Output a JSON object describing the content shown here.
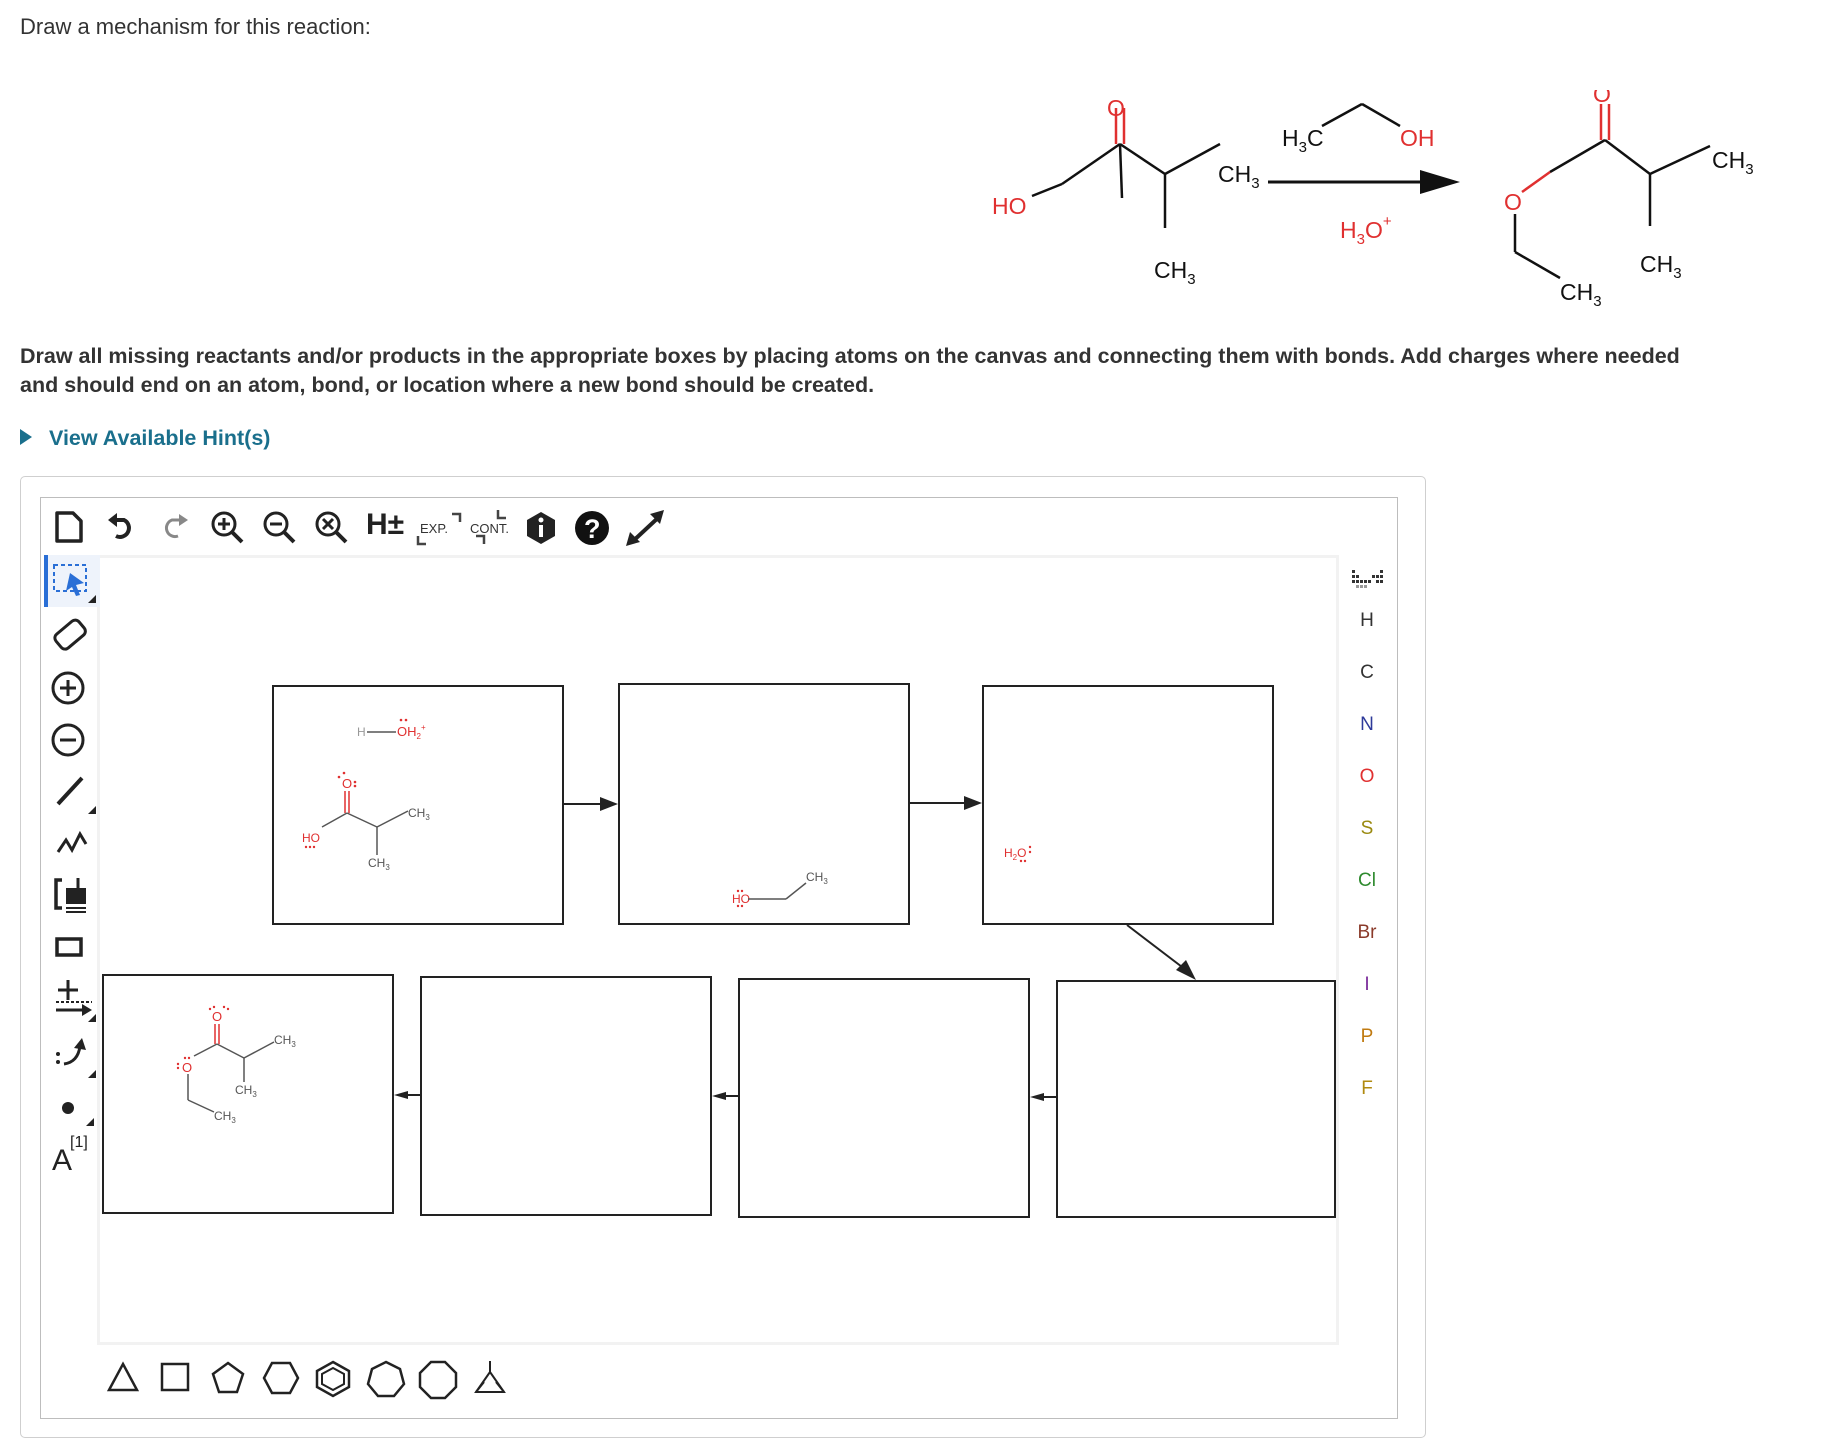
{
  "question": {
    "prompt": "Draw a mechanism for this reaction:",
    "instructions_line1": "Draw all missing reactants and/or products in the appropriate boxes by placing atoms on the canvas and connecting them with bonds. Add charges where needed",
    "instructions_line2": "and should end on an atom, bond, or location where a new bond should be created.",
    "hint_link": "View Available Hint(s)"
  },
  "reaction": {
    "reactant_labels": [
      "O",
      "HO",
      "CH3",
      "CH3"
    ],
    "reagent_labels": [
      "H3C",
      "OH",
      "H3O+"
    ],
    "product_labels": [
      "O",
      "O",
      "CH3",
      "CH3",
      "CH3"
    ]
  },
  "toolbar": {
    "h_toggle": "H±",
    "expand_label": "EXP.",
    "contract_label": "CONT."
  },
  "element_palette": [
    "H",
    "C",
    "N",
    "O",
    "S",
    "Cl",
    "Br",
    "I",
    "P",
    "F"
  ],
  "element_colors": {
    "H": "#333333",
    "C": "#333333",
    "N": "#2e3a9a",
    "O": "#e03030",
    "S": "#9a8a10",
    "Cl": "#2e8a2e",
    "Br": "#8a3a2a",
    "I": "#7a2a9a",
    "P": "#c07a10",
    "F": "#b08a10"
  },
  "left_tools": {
    "atom_map_label": "A",
    "atom_map_index": "[1]"
  },
  "mechanism_boxes": {
    "box1": {
      "labels": [
        "H",
        "OH2+",
        "O",
        "HO",
        "CH3",
        "CH3"
      ]
    },
    "box2": {
      "labels": [
        "HO",
        "CH3"
      ]
    },
    "box3": {
      "labels": [
        "H2O:"
      ]
    },
    "box8": {
      "labels": [
        "O",
        "O",
        "CH3",
        "CH3",
        "CH3"
      ]
    }
  },
  "template_shapes": [
    "triangle",
    "square",
    "pentagon",
    "hexagon",
    "benzene",
    "heptagon",
    "octagon",
    "bicyclic"
  ]
}
